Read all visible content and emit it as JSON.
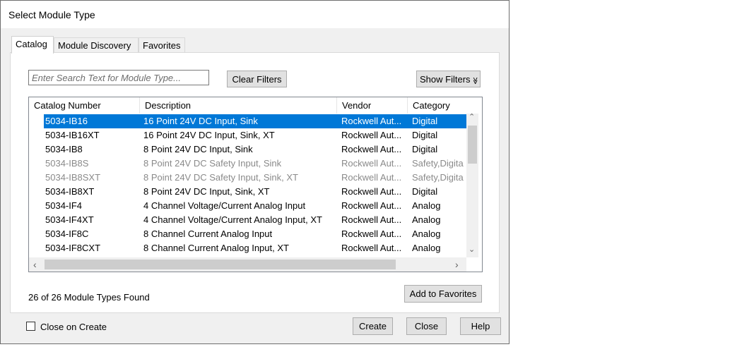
{
  "window": {
    "title": "Select Module Type"
  },
  "tabs": [
    {
      "label": "Catalog",
      "active": true
    },
    {
      "label": "Module Discovery",
      "active": false
    },
    {
      "label": "Favorites",
      "active": false
    }
  ],
  "search": {
    "placeholder": "Enter Search Text for Module Type..."
  },
  "buttons": {
    "clear_filters": "Clear Filters",
    "show_filters": "Show Filters",
    "show_filters_icon": "≫",
    "add_to_favorites": "Add to Favorites",
    "create": "Create",
    "close": "Close",
    "help": "Help"
  },
  "table": {
    "columns": [
      "Catalog Number",
      "Description",
      "Vendor",
      "Category"
    ],
    "rows": [
      {
        "catalog": "5034-IB16",
        "description": "16 Point 24V DC Input, Sink",
        "vendor": "Rockwell Aut...",
        "category": "Digital",
        "selected": true,
        "disabled": false
      },
      {
        "catalog": "5034-IB16XT",
        "description": "16 Point 24V DC Input, Sink, XT",
        "vendor": "Rockwell Aut...",
        "category": "Digital",
        "selected": false,
        "disabled": false
      },
      {
        "catalog": "5034-IB8",
        "description": "8 Point 24V DC Input, Sink",
        "vendor": "Rockwell Aut...",
        "category": "Digital",
        "selected": false,
        "disabled": false
      },
      {
        "catalog": "5034-IB8S",
        "description": "8 Point 24V DC Safety Input, Sink",
        "vendor": "Rockwell Aut...",
        "category": "Safety,Digita",
        "selected": false,
        "disabled": true
      },
      {
        "catalog": "5034-IB8SXT",
        "description": "8 Point 24V DC Safety Input, Sink, XT",
        "vendor": "Rockwell Aut...",
        "category": "Safety,Digita",
        "selected": false,
        "disabled": true
      },
      {
        "catalog": "5034-IB8XT",
        "description": "8 Point 24V DC Input, Sink, XT",
        "vendor": "Rockwell Aut...",
        "category": "Digital",
        "selected": false,
        "disabled": false
      },
      {
        "catalog": "5034-IF4",
        "description": "4 Channel Voltage/Current Analog Input",
        "vendor": "Rockwell Aut...",
        "category": "Analog",
        "selected": false,
        "disabled": false
      },
      {
        "catalog": "5034-IF4XT",
        "description": "4 Channel Voltage/Current Analog Input, XT",
        "vendor": "Rockwell Aut...",
        "category": "Analog",
        "selected": false,
        "disabled": false
      },
      {
        "catalog": "5034-IF8C",
        "description": "8 Channel Current Analog Input",
        "vendor": "Rockwell Aut...",
        "category": "Analog",
        "selected": false,
        "disabled": false
      },
      {
        "catalog": "5034-IF8CXT",
        "description": "8 Channel Current Analog Input, XT",
        "vendor": "Rockwell Aut...",
        "category": "Analog",
        "selected": false,
        "disabled": false
      }
    ]
  },
  "status": {
    "found_text": "26 of 26 Module Types Found"
  },
  "close_on_create": {
    "label": "Close on Create",
    "checked": false
  },
  "scroll_arrows": {
    "up": "⌃",
    "down": "⌄",
    "left": "‹",
    "right": "›"
  },
  "colors": {
    "selection": "#0078d7",
    "disabled_text": "#8a8a8a"
  }
}
